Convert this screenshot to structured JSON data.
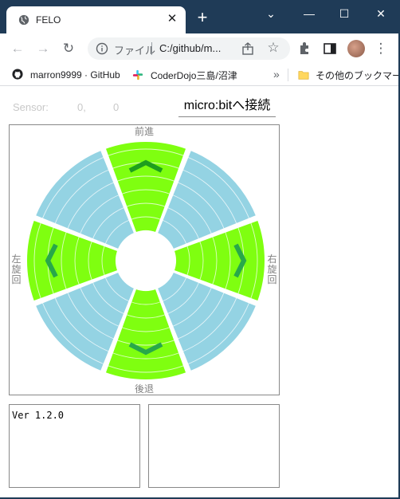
{
  "browser": {
    "tab_title": "FELO",
    "tab_close": "✕",
    "new_tab": "+",
    "window_controls": {
      "dropdown": "⌄",
      "minimize": "—",
      "maximize": "☐",
      "close": "✕"
    },
    "omnibox_label": "ファイル",
    "omnibox_url": "C:/github/m...",
    "bookmarks": [
      {
        "label": "marron9999 · GitHub",
        "icon": "github-icon"
      },
      {
        "label": "CoderDojo三島/沼津",
        "icon": "slack-icon"
      }
    ],
    "bookmarks_more": "»",
    "other_bookmarks": "その他のブックマーク"
  },
  "app": {
    "sensor_label": "Sensor:",
    "sensor_x": "0,",
    "sensor_y": "0",
    "connect_label": "micro:bitへ接続",
    "direction_labels": {
      "forward": "前進",
      "backward": "後退",
      "left": [
        "左",
        "旋",
        "回"
      ],
      "right": [
        "右",
        "旋",
        "回"
      ]
    },
    "version": "Ver 1.2.0"
  },
  "colors": {
    "active_sector": "#7fff10",
    "inactive_sector": "#94d3e3",
    "arrow": "#22a022",
    "ring_line": "#ffffff",
    "titlebar": "#1f3b57"
  }
}
